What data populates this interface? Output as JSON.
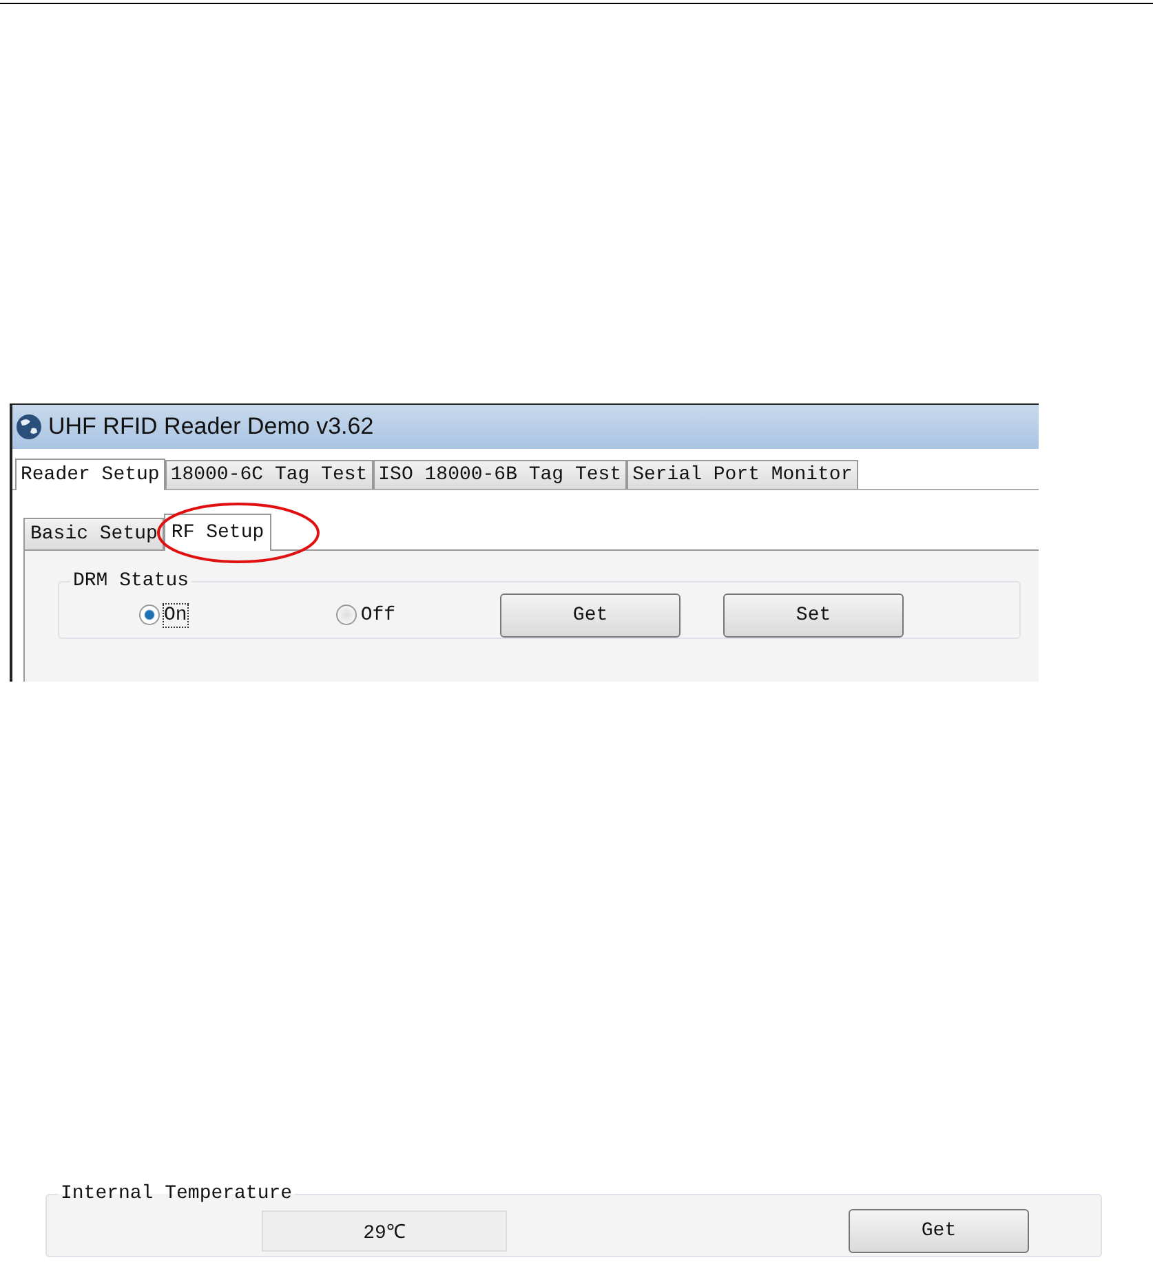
{
  "window": {
    "title": "UHF RFID Reader Demo v3.62"
  },
  "tabs": [
    {
      "label": "Reader Setup",
      "selected": true
    },
    {
      "label": "18000-6C Tag Test",
      "selected": false
    },
    {
      "label": "ISO 18000-6B Tag Test",
      "selected": false
    },
    {
      "label": "Serial Port Monitor",
      "selected": false
    }
  ],
  "subtabs": [
    {
      "label": "Basic Setup",
      "selected": false
    },
    {
      "label": "RF Setup",
      "selected": true
    }
  ],
  "drm_status": {
    "label": "DRM Status",
    "options": [
      {
        "label": "On",
        "selected": true
      },
      {
        "label": "Off",
        "selected": false
      }
    ],
    "buttons": [
      "Get",
      "Set"
    ]
  },
  "internal_temperature": {
    "label": "Internal Temperature",
    "value": "29℃",
    "buttons": [
      "Get"
    ]
  }
}
